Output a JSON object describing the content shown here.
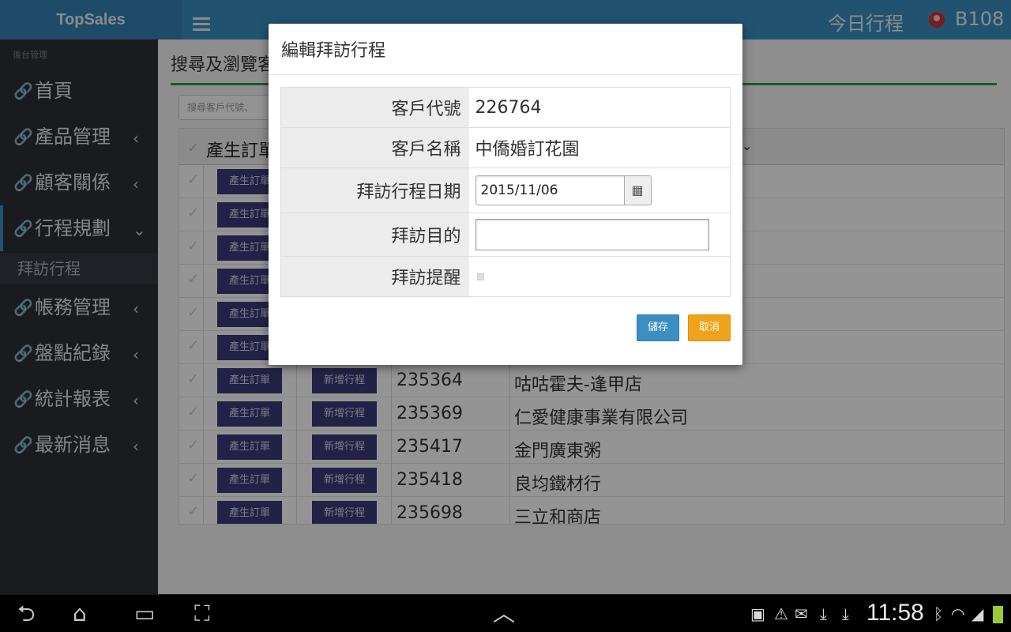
{
  "app": {
    "brand": "TopSales",
    "today_label": "今日行程",
    "user": "B108"
  },
  "sidebar": {
    "section_header": "後台管理",
    "items": [
      {
        "label": "首頁",
        "chevron": ""
      },
      {
        "label": "產品管理",
        "chevron": "‹"
      },
      {
        "label": "顧客關係",
        "chevron": "‹"
      },
      {
        "label": "行程規劃",
        "chevron": "⌄"
      },
      {
        "label": "帳務管理",
        "chevron": "‹"
      },
      {
        "label": "盤點紀錄",
        "chevron": "‹"
      },
      {
        "label": "統計報表",
        "chevron": "‹"
      },
      {
        "label": "最新消息",
        "chevron": "‹"
      }
    ],
    "sub_item": "拜訪行程"
  },
  "main": {
    "title": "搜尋及瀏覽客",
    "search_placeholder": "搜尋客戶代號、",
    "table_header": "產生訂單",
    "rows": [
      {
        "order": "產生訂單",
        "visit": "",
        "code": "",
        "name": ""
      },
      {
        "order": "產生訂單",
        "visit": "",
        "code": "",
        "name": ""
      },
      {
        "order": "產生訂單",
        "visit": "",
        "code": "",
        "name": ""
      },
      {
        "order": "產生訂單",
        "visit": "",
        "code": "",
        "name": ""
      },
      {
        "order": "產生訂單",
        "visit": "",
        "code": "",
        "name": ""
      },
      {
        "order": "產生訂單",
        "visit": "",
        "code": "",
        "name": ""
      },
      {
        "order": "產生訂單",
        "visit": "新增行程",
        "code": "235364",
        "name": "咕咕霍夫-逢甲店"
      },
      {
        "order": "產生訂單",
        "visit": "新增行程",
        "code": "235369",
        "name": "仁愛健康事業有限公司"
      },
      {
        "order": "產生訂單",
        "visit": "新增行程",
        "code": "235417",
        "name": "金門廣東粥"
      },
      {
        "order": "產生訂單",
        "visit": "新增行程",
        "code": "235418",
        "name": "良均鐵材行"
      },
      {
        "order": "產生訂單",
        "visit": "新增行程",
        "code": "235698",
        "name": "三立和商店"
      }
    ]
  },
  "modal": {
    "title": "編輯拜訪行程",
    "fields": {
      "customer_code_label": "客戶代號",
      "customer_code": "226764",
      "customer_name_label": "客戶名稱",
      "customer_name": "中僑婚訂花園",
      "visit_date_label": "拜訪行程日期",
      "visit_date": "2015/11/06",
      "purpose_label": "拜訪目的",
      "purpose_value": "",
      "reminder_label": "拜訪提醒"
    },
    "save_label": "儲存",
    "cancel_label": "取消"
  },
  "android": {
    "clock": "11:58",
    "nav_icons": [
      "back-icon",
      "home-icon",
      "recents-icon",
      "screenshot-icon",
      "up-arrow-icon"
    ],
    "status_icons": [
      "gallery-icon",
      "warning-icon",
      "mail-icon",
      "download-icon",
      "download-icon",
      "bluetooth-icon",
      "wifi-icon",
      "signal-icon",
      "battery-icon"
    ]
  },
  "colors": {
    "topbar": "#3a8fc1",
    "sidebar": "#2b2f35",
    "button_primary": "#3f3a7a",
    "save": "#3d8ec2",
    "cancel": "#f0a31a",
    "accent_rule": "#2f9a4a"
  }
}
